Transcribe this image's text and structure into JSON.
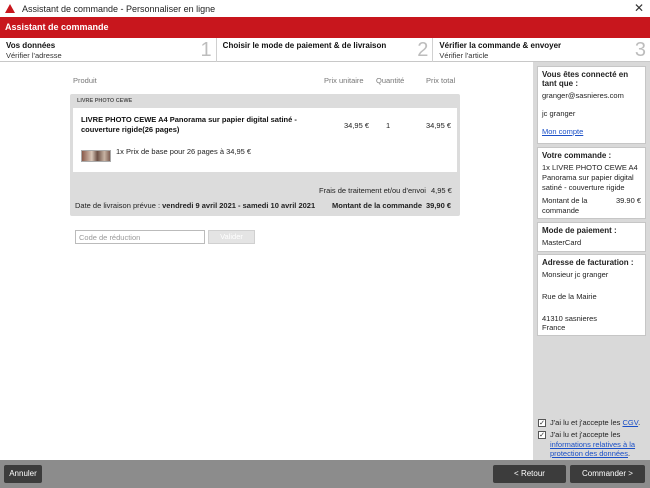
{
  "window": {
    "title": "Assistant de commande - Personnaliser en ligne"
  },
  "header": {
    "title": "Assistant de commande"
  },
  "steps": [
    {
      "title": "Vos données",
      "sub": "Vérifier l'adresse",
      "num": "1"
    },
    {
      "title": "Choisir le mode de paiement & de livraison",
      "sub": "",
      "num": "2"
    },
    {
      "title": "Vérifier la commande & envoyer",
      "sub": "Vérifier l'article",
      "num": "3"
    }
  ],
  "table": {
    "col_product": "Produit",
    "col_unit_price": "Prix unitaire",
    "col_qty": "Quantité",
    "col_total": "Prix total",
    "section_label": "LIVRE PHOTO CEWE",
    "item": {
      "name": "LIVRE PHOTO CEWE A4 Panorama sur papier digital satiné - couverture rigide(26 pages)",
      "unit_price": "34,95 €",
      "qty": "1",
      "total": "34,95 €",
      "detail": "1x Prix de base pour 26 pages à 34,95 €"
    },
    "shipping_label": "Frais de traitement et/ou d'envoi",
    "shipping_value": "4,95 €",
    "delivery_label": "Date de livraison prévue : ",
    "delivery_value": "vendredi 9 avril 2021 - samedi 10 avril 2021",
    "order_total_label": "Montant de la commande",
    "order_total_value": "39,90 €"
  },
  "discount": {
    "placeholder": "Code de réduction",
    "button": "Valider"
  },
  "sidebar": {
    "login": {
      "title": "Vous êtes connecté en tant que :",
      "email": "granger@sasnieres.com",
      "name": "jc granger",
      "account_link": "Mon compte"
    },
    "order": {
      "title": "Votre commande :",
      "line": "1x LIVRE PHOTO CEWE A4 Panorama sur papier digital satiné - couverture rigide",
      "total_label": "Montant de la commande",
      "total_value": "39.90 €"
    },
    "payment": {
      "title": "Mode de paiement :",
      "value": "MasterCard"
    },
    "billing": {
      "title": "Adresse de facturation :",
      "name": "Monsieur jc granger",
      "street": "Rue de la Mairie",
      "city": "41310 sasnieres",
      "country": "France"
    },
    "cgv": {
      "prefix": "J'ai lu et j'accepte les ",
      "link": "CGV",
      "suffix": "."
    },
    "privacy": {
      "prefix": "J'ai lu et j'accepte les ",
      "link": "informations relatives à la protection des données",
      "suffix": "."
    }
  },
  "footer": {
    "cancel": "Annuler",
    "back": "< Retour",
    "order": "Commander >"
  }
}
